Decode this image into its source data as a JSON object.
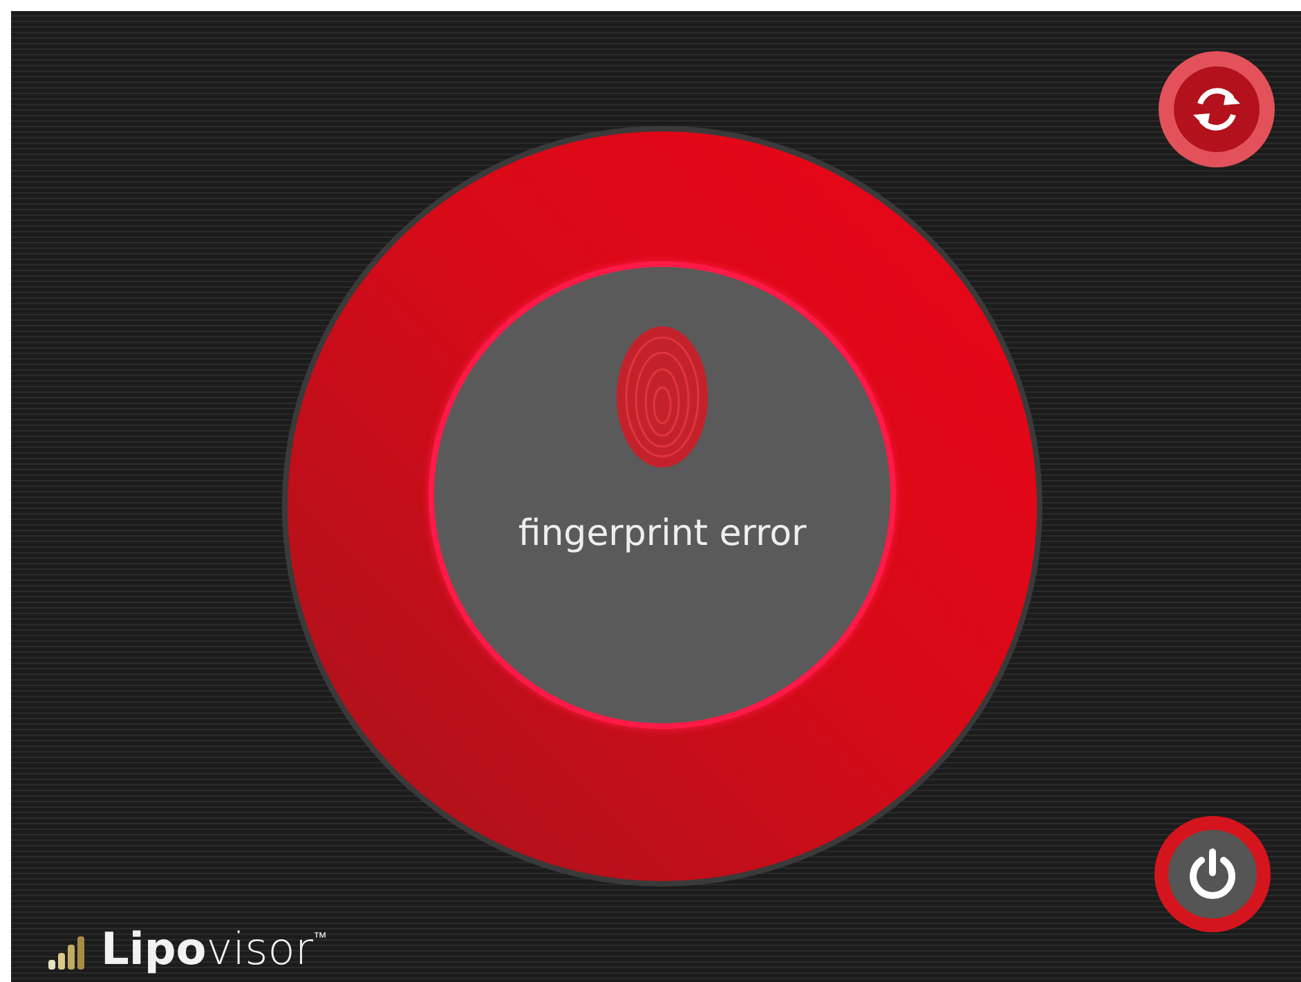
{
  "scanner": {
    "status": "fingerprint error"
  },
  "logo": {
    "text": "**Lipo**visor$^{™}$"
  }
}
